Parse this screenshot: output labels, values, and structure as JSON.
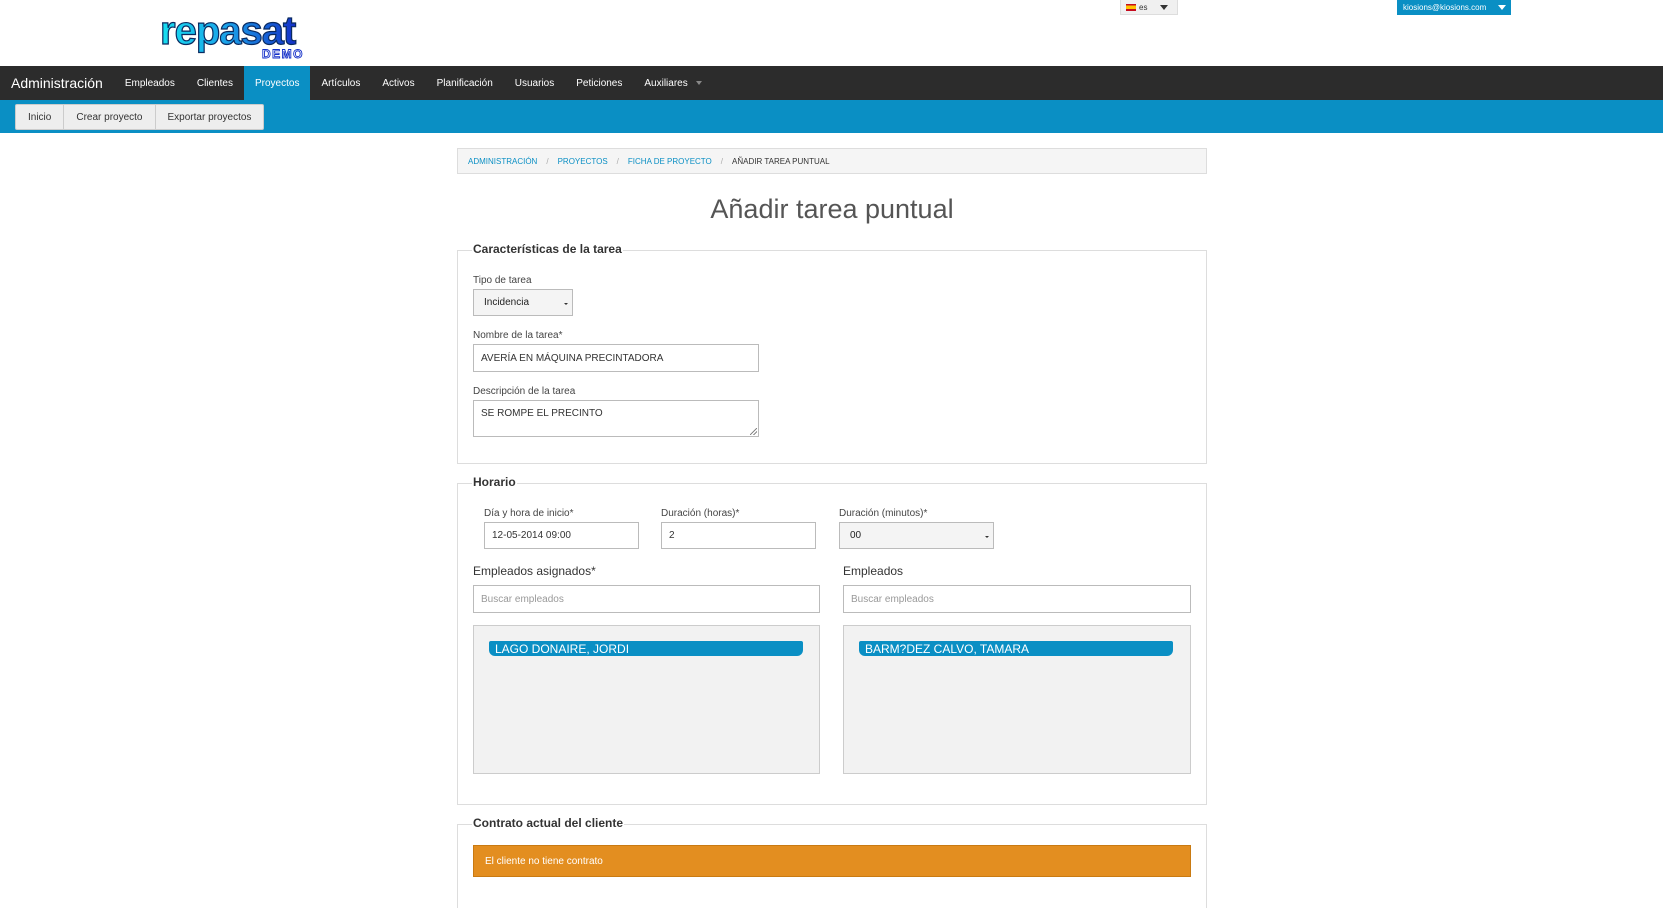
{
  "header": {
    "logo_text": "repasat",
    "logo_sub": "DEMO",
    "language": "es",
    "user_email": "kiosions@kiosions.com"
  },
  "navbar": {
    "brand": "Administración",
    "items": [
      {
        "label": "Empleados"
      },
      {
        "label": "Clientes"
      },
      {
        "label": "Proyectos",
        "active": true
      },
      {
        "label": "Artículos"
      },
      {
        "label": "Activos"
      },
      {
        "label": "Planificación"
      },
      {
        "label": "Usuarios"
      },
      {
        "label": "Peticiones"
      },
      {
        "label": "Auxiliares"
      }
    ]
  },
  "subnav": {
    "items": [
      {
        "label": "Inicio"
      },
      {
        "label": "Crear proyecto"
      },
      {
        "label": "Exportar proyectos"
      }
    ]
  },
  "breadcrumb": {
    "items": [
      "Administración",
      "Proyectos",
      "Ficha de proyecto"
    ],
    "current": "Añadir tarea puntual"
  },
  "page_title": "Añadir tarea puntual",
  "caracteristicas": {
    "legend": "Características de la tarea",
    "tipo_label": "Tipo de tarea",
    "tipo_value": "Incidencia",
    "nombre_label": "Nombre de la tarea*",
    "nombre_value": "AVERÍA EN MÁQUINA PRECINTADORA",
    "descripcion_label": "Descripción de la tarea",
    "descripcion_value": "SE ROMPE EL PRECINTO"
  },
  "horario": {
    "legend": "Horario",
    "inicio_label": "Día y hora de inicio*",
    "inicio_value": "12-05-2014 09:00",
    "horas_label": "Duración (horas)*",
    "horas_value": "2",
    "minutos_label": "Duración (minutos)*",
    "minutos_value": "00",
    "asignados_label": "Empleados asignados*",
    "asignados_placeholder": "Buscar empleados",
    "asignados_items": [
      "LAGO DONAIRE, JORDI"
    ],
    "empleados_label": "Empleados",
    "empleados_placeholder": "Buscar empleados",
    "empleados_items": [
      "BARM?DEZ CALVO, TAMARA"
    ]
  },
  "contrato": {
    "legend": "Contrato actual del cliente",
    "alert": "El cliente no tiene contrato"
  },
  "colors": {
    "accent": "#0a8fc4",
    "navbar": "#2c2c2c",
    "warning": "#e38e20"
  }
}
